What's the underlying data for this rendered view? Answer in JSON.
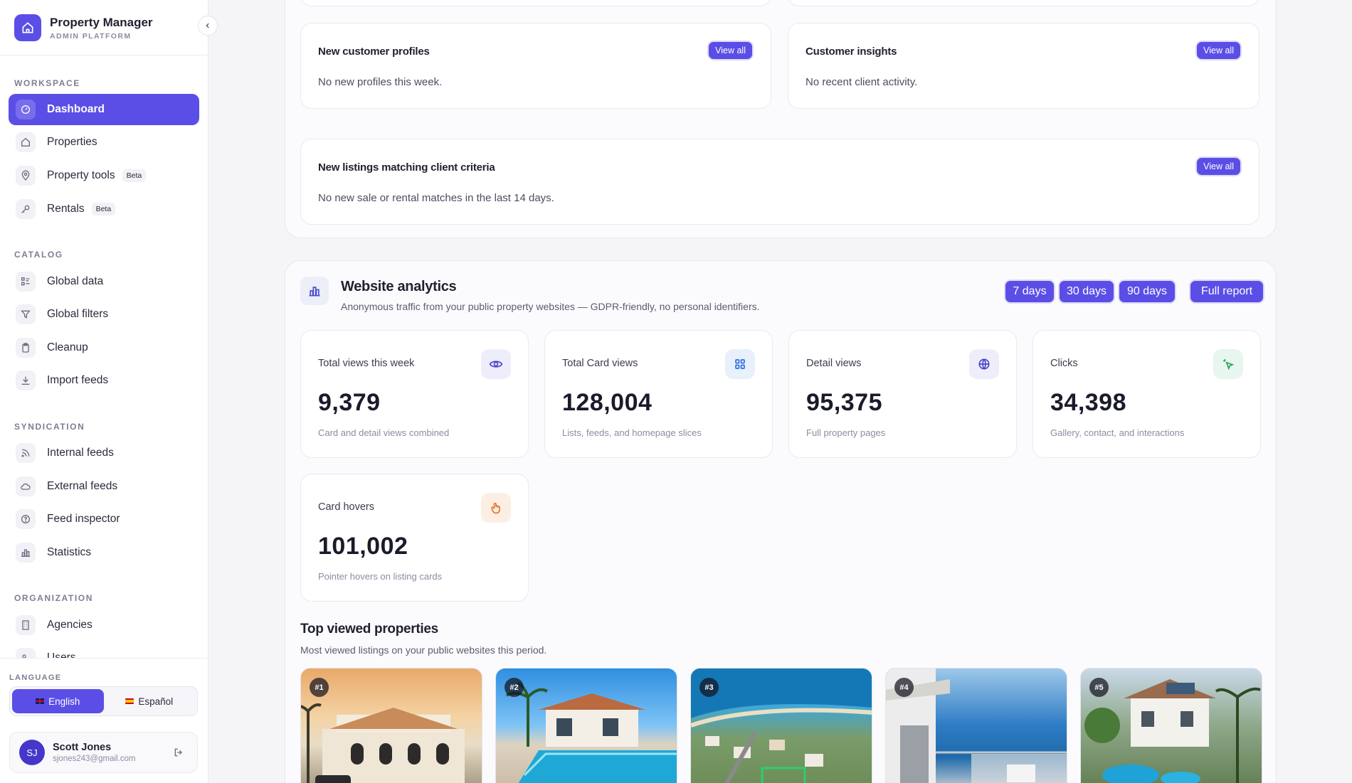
{
  "brand": {
    "title": "Property Manager",
    "subtitle": "ADMIN PLATFORM"
  },
  "sidebar": {
    "sections": [
      {
        "title": "WORKSPACE",
        "items": [
          {
            "label": "Dashboard",
            "icon": "dashboard-icon",
            "active": true
          },
          {
            "label": "Properties",
            "icon": "home-icon"
          },
          {
            "label": "Property tools",
            "icon": "map-pin-icon",
            "badge": "Beta"
          },
          {
            "label": "Rentals",
            "icon": "key-icon",
            "badge": "Beta"
          }
        ]
      },
      {
        "title": "CATALOG",
        "items": [
          {
            "label": "Global data",
            "icon": "list-icon"
          },
          {
            "label": "Global filters",
            "icon": "filter-icon"
          },
          {
            "label": "Cleanup",
            "icon": "clipboard-icon"
          },
          {
            "label": "Import feeds",
            "icon": "download-icon"
          }
        ]
      },
      {
        "title": "SYNDICATION",
        "items": [
          {
            "label": "Internal feeds",
            "icon": "rss-icon"
          },
          {
            "label": "External feeds",
            "icon": "cloud-icon"
          },
          {
            "label": "Feed inspector",
            "icon": "help-circle-icon"
          },
          {
            "label": "Statistics",
            "icon": "bar-chart-icon"
          }
        ]
      },
      {
        "title": "ORGANIZATION",
        "items": [
          {
            "label": "Agencies",
            "icon": "building-icon"
          },
          {
            "label": "Users",
            "icon": "users-icon"
          }
        ]
      }
    ]
  },
  "language": {
    "title": "LANGUAGE",
    "options": [
      {
        "label": "English",
        "active": true
      },
      {
        "label": "Español",
        "active": false
      }
    ]
  },
  "user": {
    "initials": "SJ",
    "name": "Scott Jones",
    "email": "sjones243@gmail.com"
  },
  "cards": {
    "new_profiles": {
      "title": "New customer profiles",
      "text": "No new profiles this week.",
      "button": "View all"
    },
    "insights": {
      "title": "Customer insights",
      "text": "No recent client activity.",
      "button": "View all"
    },
    "listings": {
      "title": "New listings matching client criteria",
      "text": "No new sale or rental matches in the last 14 days.",
      "button": "View all"
    }
  },
  "analytics": {
    "title": "Website analytics",
    "subtitle": "Anonymous traffic from your public property websites — GDPR-friendly, no personal identifiers.",
    "ranges": [
      "7 days",
      "30 days",
      "90 days"
    ],
    "report_button": "Full report",
    "metrics": [
      {
        "label": "Total views this week",
        "value": "9,379",
        "sub": "Card and detail views combined",
        "icon": "eye-icon",
        "color": "#5b4ee6"
      },
      {
        "label": "Total Card views",
        "value": "128,004",
        "sub": "Lists, feeds, and homepage slices",
        "icon": "grid-icon",
        "color": "#2f6fe0"
      },
      {
        "label": "Detail views",
        "value": "95,375",
        "sub": "Full property pages",
        "icon": "globe-icon",
        "color": "#5b4ee6"
      },
      {
        "label": "Clicks",
        "value": "34,398",
        "sub": "Gallery, contact, and interactions",
        "icon": "click-icon",
        "color": "#22a35a"
      },
      {
        "label": "Card hovers",
        "value": "101,002",
        "sub": "Pointer hovers on listing cards",
        "icon": "hand-pointer-icon",
        "color": "#e8742b"
      }
    ]
  },
  "top_viewed": {
    "title": "Top viewed properties",
    "subtitle": "Most viewed listings on your public websites this period.",
    "items": [
      {
        "rank": "#1"
      },
      {
        "rank": "#2"
      },
      {
        "rank": "#3"
      },
      {
        "rank": "#4"
      },
      {
        "rank": "#5"
      }
    ]
  },
  "colors": {
    "accent": "#5b4ee6",
    "background": "#f5f5f8"
  }
}
